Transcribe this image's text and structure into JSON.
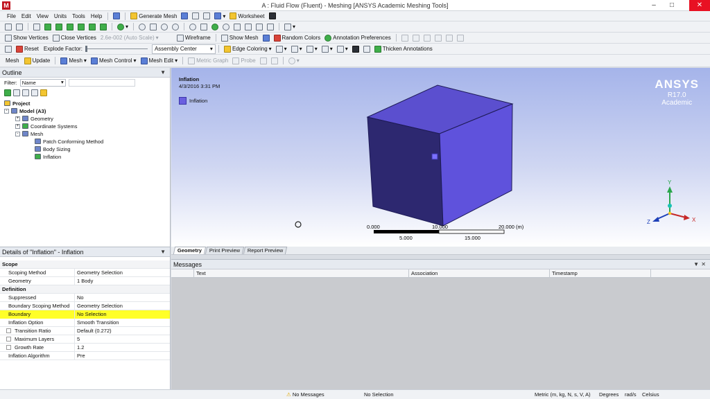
{
  "window": {
    "title": "A : Fluid Flow (Fluent) - Meshing [ANSYS Academic Meshing Tools]"
  },
  "menu": [
    "File",
    "Edit",
    "View",
    "Units",
    "Tools",
    "Help"
  ],
  "toolbar1": {
    "generate_mesh": "Generate Mesh",
    "worksheet": "Worksheet"
  },
  "toolbar2": {
    "show_vertices": "Show Vertices",
    "close_vertices": "Close Vertices",
    "scale_value": "2.6e-002 (Auto Scale)",
    "wireframe": "Wireframe",
    "show_mesh": "Show Mesh",
    "random_colors": "Random Colors",
    "annotation_preferences": "Annotation Preferences"
  },
  "toolbar3": {
    "reset": "Reset",
    "explode_factor": "Explode Factor:",
    "assembly_center": "Assembly Center",
    "edge_coloring": "Edge Coloring",
    "thicken_annotations": "Thicken Annotations"
  },
  "toolbar4": {
    "mesh_label": "Mesh",
    "update": "Update",
    "mesh": "Mesh",
    "mesh_control": "Mesh Control",
    "mesh_edit": "Mesh Edit",
    "metric_graph": "Metric Graph",
    "probe": "Probe"
  },
  "outline": {
    "title": "Outline",
    "filter_label": "Filter:",
    "filter_value": "Name",
    "tree": {
      "project": "Project",
      "model": "Model (A3)",
      "geometry": "Geometry",
      "coordinate_systems": "Coordinate Systems",
      "mesh": "Mesh",
      "patch_conforming": "Patch Conforming Method",
      "body_sizing": "Body Sizing",
      "inflation": "Inflation"
    }
  },
  "details": {
    "title": "Details of \"Inflation\" - Inflation",
    "rows": [
      {
        "type": "sec",
        "k": "Scope"
      },
      {
        "k": "Scoping Method",
        "v": "Geometry Selection"
      },
      {
        "k": "Geometry",
        "v": "1 Body"
      },
      {
        "type": "sec",
        "k": "Definition"
      },
      {
        "k": "Suppressed",
        "v": "No"
      },
      {
        "k": "Boundary Scoping Method",
        "v": "Geometry Selection"
      },
      {
        "type": "hl",
        "k": "Boundary",
        "v": "No Selection"
      },
      {
        "k": "Inflation Option",
        "v": "Smooth Transition"
      },
      {
        "type": "sub",
        "k": "Transition Ratio",
        "v": "Default (0.272)"
      },
      {
        "type": "sub",
        "k": "Maximum Layers",
        "v": "5"
      },
      {
        "type": "sub",
        "k": "Growth Rate",
        "v": "1.2"
      },
      {
        "k": "Inflation Algorithm",
        "v": "Pre"
      }
    ]
  },
  "viewport": {
    "title": "Inflation",
    "date": "4/3/2016 3:31 PM",
    "legend": "Inflation",
    "brand": "ANSYS",
    "version": "R17.0",
    "edition": "Academic",
    "scale_top": [
      "0.000",
      "10.000",
      "20.000 (m)"
    ],
    "scale_bottom": [
      "5.000",
      "15.000"
    ],
    "axis_labels": {
      "x": "X",
      "y": "Y",
      "z": "Z"
    },
    "colors": {
      "cube_top": "#5b4fcf",
      "cube_left": "#2d2870",
      "cube_right": "#5f52dc"
    }
  },
  "view_tabs": [
    "Geometry",
    "Print Preview",
    "Report Preview"
  ],
  "messages": {
    "title": "Messages",
    "columns": [
      "Text",
      "Association",
      "Timestamp"
    ]
  },
  "status": {
    "messages": "No Messages",
    "selection": "No Selection",
    "units": "Metric (m, kg, N, s, V, A)",
    "angle": "Degrees",
    "rate": "rad/s",
    "temp": "Celsius"
  }
}
